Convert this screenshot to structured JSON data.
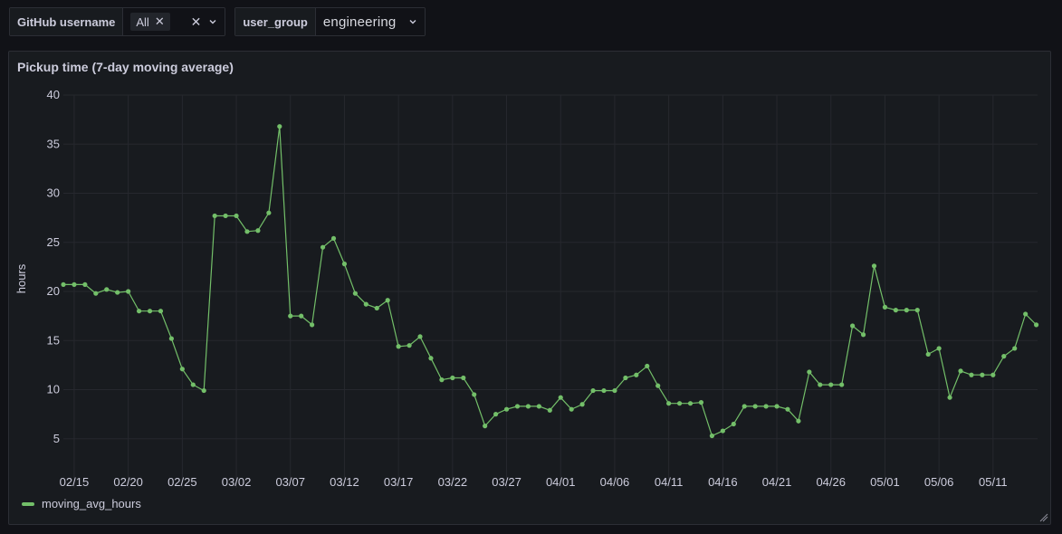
{
  "variables": {
    "github": {
      "label": "GitHub username",
      "chip": "All",
      "chip_remove_icon": "close-icon",
      "clear_icon": "close-icon",
      "dropdown_icon": "chevron-down-icon"
    },
    "user_group": {
      "label": "user_group",
      "value": "engineering",
      "dropdown_icon": "chevron-down-icon"
    }
  },
  "panel": {
    "title": "Pickup time (7-day moving average)"
  },
  "colors": {
    "series": "#73bf69",
    "grid": "#26282e",
    "text": "#ccccdc",
    "panel_bg": "#181b1f",
    "page_bg": "#111217"
  },
  "chart_data": {
    "type": "line",
    "title": "Pickup time (7-day moving average)",
    "xlabel": "",
    "ylabel": "hours",
    "ylim": [
      0,
      40
    ],
    "yticks": [
      5,
      10,
      15,
      20,
      25,
      30,
      35,
      40
    ],
    "xtick_labels": [
      "02/15",
      "02/20",
      "02/25",
      "03/02",
      "03/07",
      "03/12",
      "03/17",
      "03/22",
      "03/27",
      "04/01",
      "04/06",
      "04/11",
      "04/16",
      "04/21",
      "04/26",
      "05/01",
      "05/06",
      "05/11"
    ],
    "grid": true,
    "legend_position": "bottom-left",
    "x": [
      "02/14",
      "02/15",
      "02/16",
      "02/17",
      "02/18",
      "02/19",
      "02/20",
      "02/21",
      "02/22",
      "02/23",
      "02/24",
      "02/25",
      "02/26",
      "02/27",
      "02/28",
      "03/01",
      "03/02",
      "03/03",
      "03/04",
      "03/05",
      "03/06",
      "03/07",
      "03/08",
      "03/09",
      "03/10",
      "03/11",
      "03/12",
      "03/13",
      "03/14",
      "03/15",
      "03/16",
      "03/17",
      "03/18",
      "03/19",
      "03/20",
      "03/21",
      "03/22",
      "03/23",
      "03/24",
      "03/25",
      "03/26",
      "03/27",
      "03/28",
      "03/29",
      "03/30",
      "03/31",
      "04/01",
      "04/02",
      "04/03",
      "04/04",
      "04/05",
      "04/06",
      "04/07",
      "04/08",
      "04/09",
      "04/10",
      "04/11",
      "04/12",
      "04/13",
      "04/14",
      "04/15",
      "04/16",
      "04/17",
      "04/18",
      "04/19",
      "04/20",
      "04/21",
      "04/22",
      "04/23",
      "04/24",
      "04/25",
      "04/26",
      "04/27",
      "04/28",
      "04/29",
      "04/30",
      "05/01",
      "05/02",
      "05/03",
      "05/04",
      "05/05",
      "05/06",
      "05/07",
      "05/08",
      "05/09",
      "05/10",
      "05/11",
      "05/12",
      "05/13",
      "05/14",
      "05/15"
    ],
    "series": [
      {
        "name": "moving_avg_hours",
        "values": [
          20.7,
          20.7,
          20.7,
          19.8,
          20.2,
          19.9,
          20.0,
          18.0,
          18.0,
          18.0,
          15.2,
          12.1,
          10.5,
          9.9,
          27.7,
          27.7,
          27.7,
          26.1,
          26.2,
          28.0,
          36.8,
          17.5,
          17.5,
          16.6,
          24.5,
          25.4,
          22.8,
          19.8,
          18.7,
          18.3,
          19.1,
          14.4,
          14.5,
          15.4,
          13.2,
          11.0,
          11.2,
          11.2,
          9.5,
          6.3,
          7.5,
          8.0,
          8.3,
          8.3,
          8.3,
          7.9,
          9.2,
          8.0,
          8.5,
          9.9,
          9.9,
          9.9,
          11.2,
          11.5,
          12.4,
          10.4,
          8.6,
          8.6,
          8.6,
          8.7,
          5.3,
          5.8,
          6.5,
          8.3,
          8.3,
          8.3,
          8.3,
          8.0,
          6.8,
          11.8,
          10.5,
          10.5,
          10.5,
          16.5,
          15.6,
          22.6,
          18.4,
          18.1,
          18.1,
          18.1,
          13.6,
          14.2,
          9.2,
          11.9,
          11.5,
          11.5,
          11.5,
          13.4,
          14.2,
          17.7,
          16.6
        ]
      }
    ]
  }
}
